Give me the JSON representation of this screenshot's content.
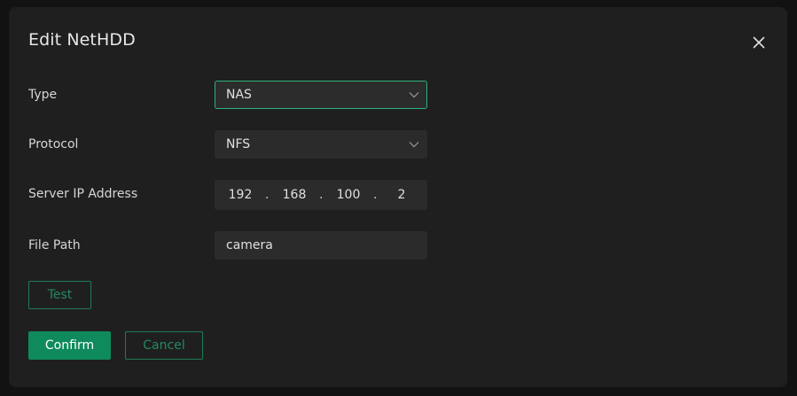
{
  "dialog": {
    "title": "Edit NetHDD",
    "close_icon": "close-icon"
  },
  "form": {
    "type": {
      "label": "Type",
      "value": "NAS",
      "icon": "chevron-down-icon"
    },
    "protocol": {
      "label": "Protocol",
      "value": "NFS",
      "icon": "chevron-down-icon"
    },
    "server_ip": {
      "label": "Server IP Address",
      "octets": [
        "192",
        "168",
        "100",
        "2"
      ],
      "separator": "."
    },
    "file_path": {
      "label": "File Path",
      "value": "camera"
    }
  },
  "buttons": {
    "test": "Test",
    "confirm": "Confirm",
    "cancel": "Cancel"
  },
  "colors": {
    "accent": "#0f8a5c",
    "accent_border": "#2fb07b",
    "dialog_bg": "#1f1f1f",
    "field_bg": "#2b2b2b"
  }
}
